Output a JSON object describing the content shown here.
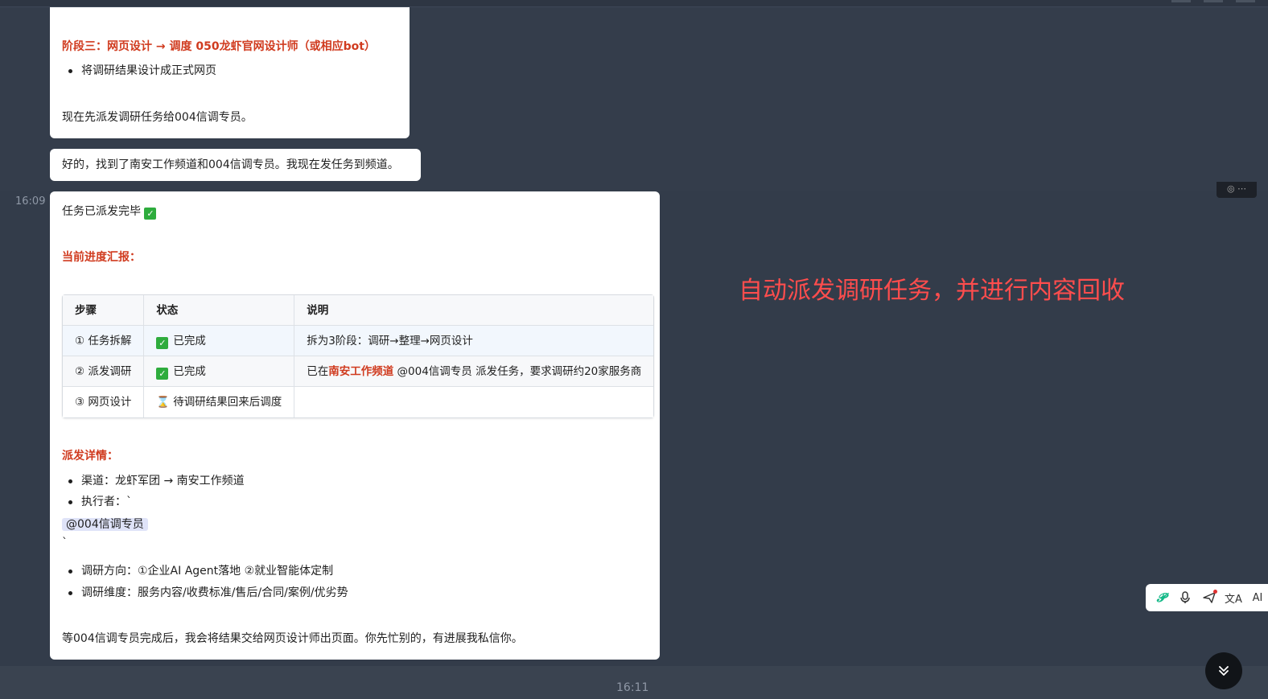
{
  "message1": {
    "stage3_heading": "阶段三：网页设计 → 调度 050龙虾官网设计师（或相应bot）",
    "stage3_bullet": "将调研结果设计成正式网页",
    "closing": "现在先派发调研任务给004信调专员。"
  },
  "message2": {
    "text": "好的，找到了南安工作频道和004信调专员。我现在发任务到频道。"
  },
  "message3": {
    "timestamp": "16:09",
    "intro": "任务已派发完毕",
    "progress_heading": "当前进度汇报：",
    "table": {
      "headers": [
        "步骤",
        "状态",
        "说明"
      ],
      "rows": [
        {
          "step": "① 任务拆解",
          "status": "已完成",
          "status_icon": "check-icon",
          "note": "拆为3阶段：调研→整理→网页设计"
        },
        {
          "step": "② 派发调研",
          "status": "已完成",
          "status_icon": "check-icon",
          "note_prefix": "已在",
          "note_channel": "南安工作频道",
          "note_suffix": " @004信调专员 派发任务，要求调研约20家服务商"
        },
        {
          "step": "③ 网页设计",
          "status": "待调研结果回来后调度",
          "status_icon": "hourglass-icon",
          "note": ""
        }
      ]
    },
    "dispatch_heading": "派发详情：",
    "dispatch_bullets": [
      "渠道：龙虾军团 → 南安工作频道",
      "执行者：`"
    ],
    "mention": "@004信调专员",
    "backtick": "`",
    "research_bullets": [
      "调研方向：①企业AI Agent落地 ②就业智能体定制",
      "调研维度：服务内容/收费标准/售后/合同/案例/优劣势"
    ],
    "closing": "等004信调专员完成后，我会将结果交给网页设计师出页面。你先忙别的，有进展我私信你。"
  },
  "overlay_caption": "自动派发调研任务，并进行内容回收",
  "next_timestamp": "16:11",
  "toolbar": {
    "items": [
      "p-logo-icon",
      "microphone-icon",
      "send-icon",
      "translate-icon",
      "ai-icon"
    ],
    "ai_label": "AI"
  },
  "colors": {
    "background": "#343d4b",
    "accent_red": "#d03b1f",
    "caption_red": "#ff4d4d"
  }
}
